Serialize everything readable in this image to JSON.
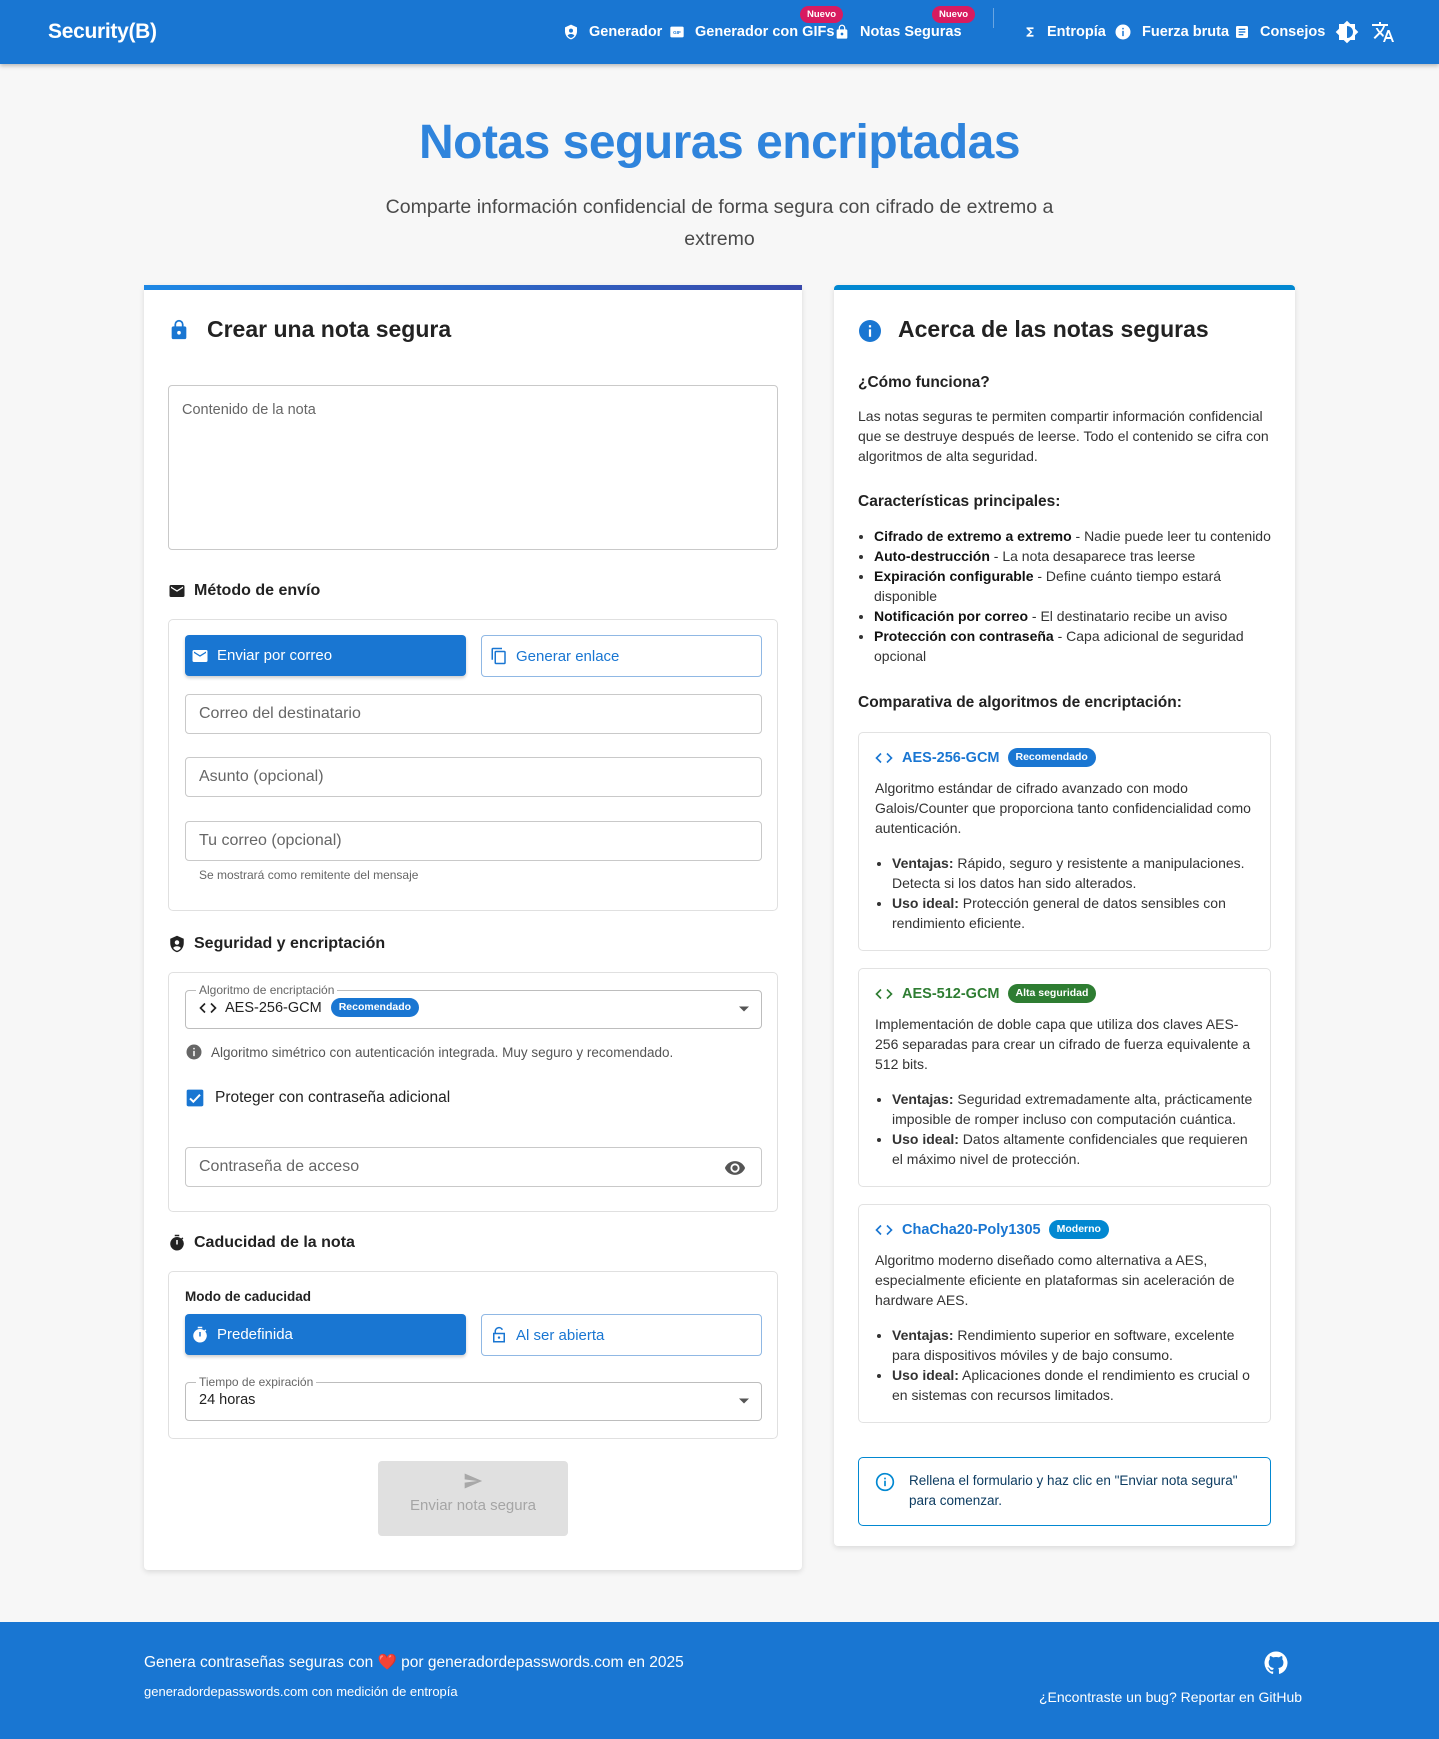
{
  "app": {
    "brand": "Security(B)"
  },
  "nav": {
    "items": [
      {
        "label": "Generador",
        "icon": "shield-icon"
      },
      {
        "label": "Generador con GIFs",
        "icon": "gif-icon",
        "badge": "Nuevo"
      },
      {
        "label": "Notas Seguras",
        "icon": "lock-icon",
        "badge": "Nuevo"
      },
      {
        "label": "Entropía",
        "icon": "sigma-icon"
      },
      {
        "label": "Fuerza bruta",
        "icon": "info-icon"
      },
      {
        "label": "Consejos",
        "icon": "article-icon"
      }
    ],
    "icons": [
      "theme-toggle-icon",
      "translate-icon"
    ]
  },
  "hero": {
    "title": "Notas seguras encriptadas",
    "subtitle": "Comparte información confidencial de forma segura con cifrado de extremo a extremo"
  },
  "create": {
    "title": "Crear una nota segura",
    "note_placeholder": "Contenido de la nota",
    "delivery": {
      "title": "Método de envío",
      "email_button": "Enviar por correo",
      "link_button": "Generar enlace",
      "recipient_placeholder": "Correo del destinatario",
      "subject_placeholder": "Asunto (opcional)",
      "sender_placeholder": "Tu correo (opcional)",
      "sender_helper": "Se mostrará como remitente del mensaje"
    },
    "security": {
      "title": "Seguridad y encriptación",
      "algorithm_label": "Algoritmo de encriptación",
      "algorithm_value": "AES-256-GCM",
      "algorithm_chip": "Recomendado",
      "algorithm_info": "Algoritmo simétrico con autenticación integrada. Muy seguro y recomendado.",
      "password_checkbox_label": "Proteger con contraseña adicional",
      "password_checked": true,
      "password_placeholder": "Contraseña de acceso"
    },
    "expiry": {
      "title": "Caducidad de la nota",
      "mode_label": "Modo de caducidad",
      "predefined_button": "Predefinida",
      "on_open_button": "Al ser abierta",
      "time_label": "Tiempo de expiración",
      "time_value": "24 horas"
    },
    "submit_label": "Enviar nota segura"
  },
  "about": {
    "title": "Acerca de las notas seguras",
    "how_title": "¿Cómo funciona?",
    "how_text": "Las notas seguras te permiten compartir información confidencial que se destruye después de leerse. Todo el contenido se cifra con algoritmos de alta seguridad.",
    "features_title": "Características principales:",
    "features": [
      {
        "bold": "Cifrado de extremo a extremo",
        "text": " - Nadie puede leer tu contenido"
      },
      {
        "bold": "Auto-destrucción",
        "text": " - La nota desaparece tras leerse"
      },
      {
        "bold": "Expiración configurable",
        "text": " - Define cuánto tiempo estará disponible"
      },
      {
        "bold": "Notificación por correo",
        "text": " - El destinatario recibe un aviso"
      },
      {
        "bold": "Protección con contraseña",
        "text": " - Capa adicional de seguridad opcional"
      }
    ],
    "compare_title": "Comparativa de algoritmos de encriptación:",
    "algorithms": [
      {
        "name": "AES-256-GCM",
        "chip": "Recomendado",
        "chip_color": "#1976d2",
        "desc": "Algoritmo estándar de cifrado avanzado con modo Galois/Counter que proporciona tanto confidencialidad como autenticación.",
        "pros_label": "Ventajas:",
        "pros": " Rápido, seguro y resistente a manipulaciones. Detecta si los datos han sido alterados.",
        "use_label": "Uso ideal:",
        "use": " Protección general de datos sensibles con rendimiento eficiente."
      },
      {
        "name": "AES-512-GCM",
        "chip": "Alta seguridad",
        "chip_color": "#2e7d32",
        "desc": "Implementación de doble capa que utiliza dos claves AES-256 separadas para crear un cifrado de fuerza equivalente a 512 bits.",
        "pros_label": "Ventajas:",
        "pros": " Seguridad extremadamente alta, prácticamente imposible de romper incluso con computación cuántica.",
        "use_label": "Uso ideal:",
        "use": " Datos altamente confidenciales que requieren el máximo nivel de protección."
      },
      {
        "name": "ChaCha20-Poly1305",
        "chip": "Moderno",
        "chip_color": "#0288d1",
        "desc": "Algoritmo moderno diseñado como alternativa a AES, especialmente eficiente en plataformas sin aceleración de hardware AES.",
        "pros_label": "Ventajas:",
        "pros": " Rendimiento superior en software, excelente para dispositivos móviles y de bajo consumo.",
        "use_label": "Uso ideal:",
        "use": " Aplicaciones donde el rendimiento es crucial o en sistemas con recursos limitados."
      }
    ],
    "tip": "Rellena el formulario y haz clic en \"Enviar nota segura\" para comenzar."
  },
  "footer": {
    "line1_a": "Genera contraseñas seguras con",
    "line1_heart": "❤️",
    "line1_b": "por generadordepasswords.com en 2025",
    "line2": "generadordepasswords.com con medición de entropía",
    "bug_link": "¿Encontraste un bug? Reportar en GitHub"
  },
  "colors": {
    "primary": "#1976d2",
    "hero_title": "#2f84dc",
    "recommended": "#1976d2",
    "high_security": "#2e7d32",
    "modern": "#0288d1"
  }
}
